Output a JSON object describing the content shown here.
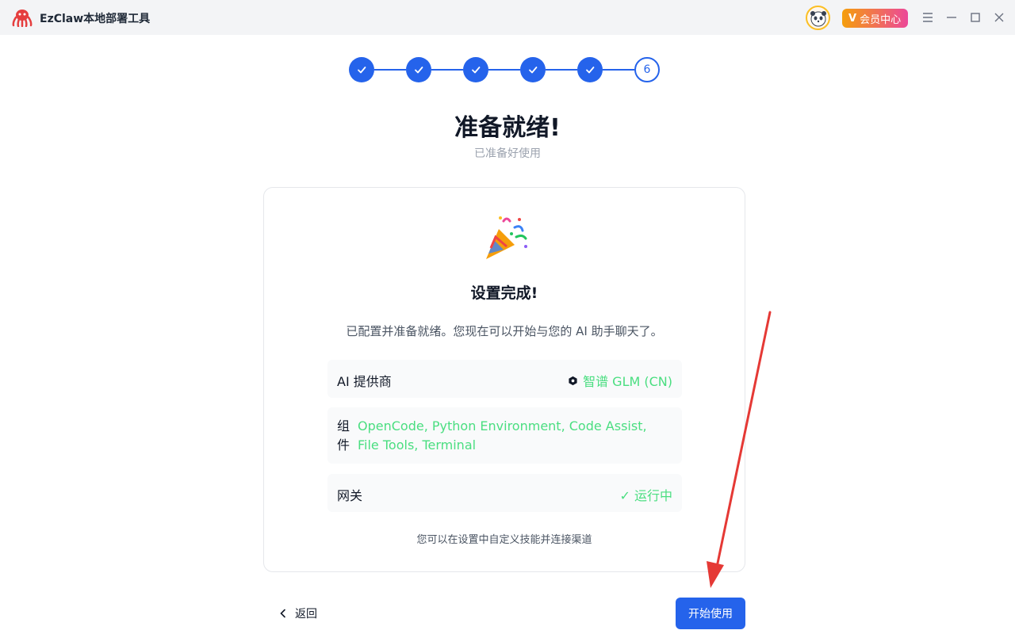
{
  "app": {
    "title": "EzClaw本地部署工具",
    "vip_badge": "会员中心",
    "vip_letter": "V"
  },
  "window_controls": [
    "menu-icon",
    "minimize-icon",
    "maximize-icon",
    "close-icon"
  ],
  "stepper": {
    "completed_steps": 5,
    "current_step": "6"
  },
  "page": {
    "title": "准备就绪!",
    "subtitle": "已准备好使用"
  },
  "card": {
    "icon": "party-popper-icon",
    "title": "设置完成!",
    "description": "已配置并准备就绪。您现在可以开始与您的 AI 助手聊天了。",
    "rows": [
      {
        "label": "AI 提供商",
        "value": "智谱 GLM (CN)",
        "icon": "hexagon-logo-icon"
      },
      {
        "label": "组件",
        "value": "OpenCode, Python Environment, Code Assist, File Tools, Terminal"
      },
      {
        "label": "网关",
        "value": "✓ 运行中"
      }
    ],
    "note": "您可以在设置中自定义技能并连接渠道"
  },
  "footer": {
    "back_label": "返回",
    "start_label": "开始使用"
  },
  "colors": {
    "primary": "#2563eb",
    "success": "#4ade80",
    "annotation": "#e53935"
  }
}
